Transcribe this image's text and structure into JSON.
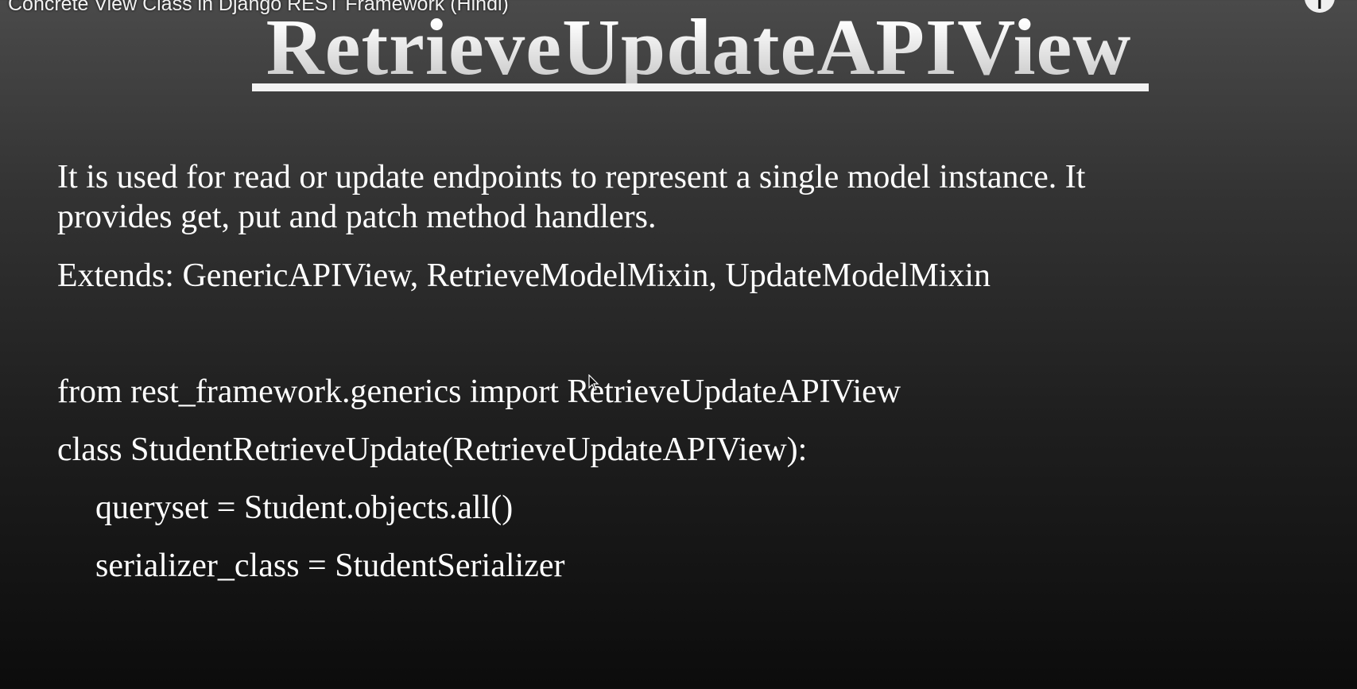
{
  "video": {
    "title": "Concrete View Class in Django REST Framework (Hindi)",
    "info_icon": "info-icon"
  },
  "slide": {
    "title": "RetrieveUpdateAPIView",
    "description_line1": "It is used for read or update endpoints to represent a single model instance. It",
    "description_line2": "provides get, put and patch method handlers.",
    "extends": "Extends: GenericAPIView, RetrieveModelMixin, UpdateModelMixin",
    "code": {
      "import_line": "from rest_framework.generics import RetrieveUpdateAPIView",
      "class_line": "class StudentRetrieveUpdate(RetrieveUpdateAPIView):",
      "queryset_line": "queryset = Student.objects.all()",
      "serializer_line": "serializer_class = StudentSerializer"
    }
  }
}
